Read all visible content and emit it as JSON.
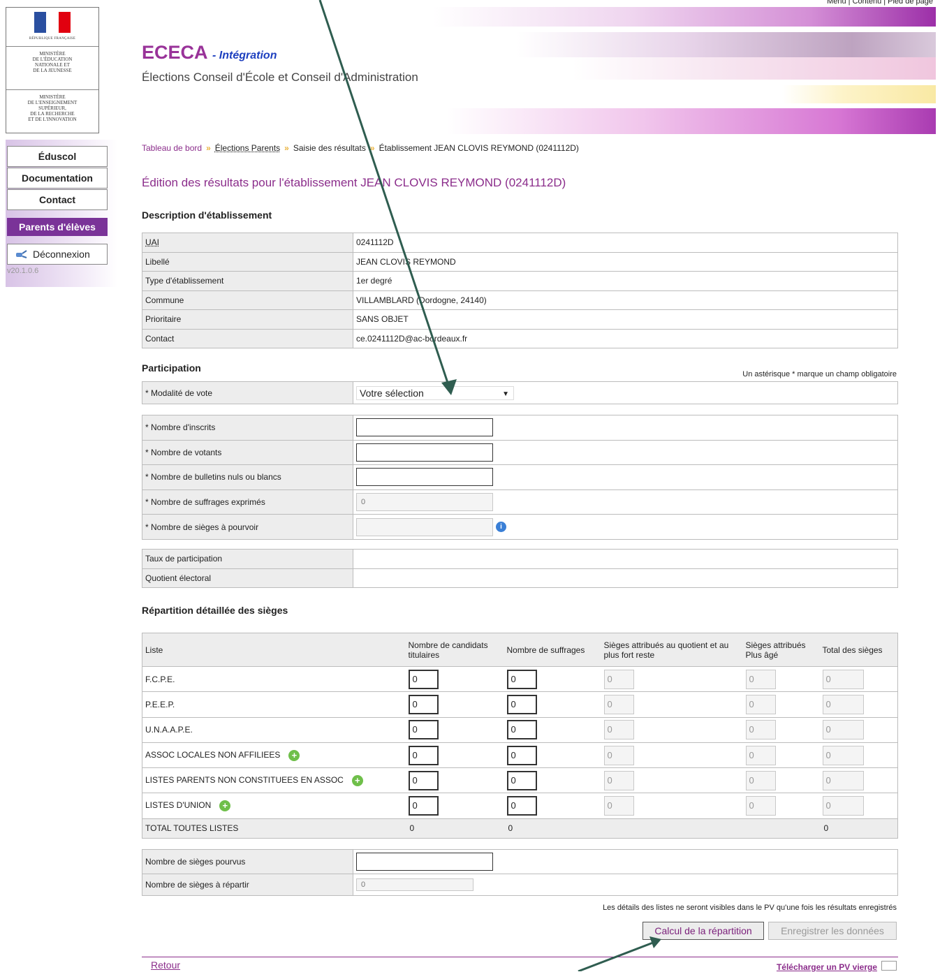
{
  "top_links": "Menu | Contenu | Pied de page",
  "app": {
    "title": "ECECA",
    "subtitle_tag": "- Intégration",
    "subtitle": "Élections Conseil d'École et Conseil d'Administration"
  },
  "logo": {
    "republique": "RÉPUBLIQUE FRANÇAISE",
    "ministry1": "MINISTÈRE\nDE L'ÉDUCATION\nNATIONALE ET\nDE LA JEUNESSE",
    "ministry2": "MINISTÈRE\nDE L'ENSEIGNEMENT\nSUPÉRIEUR,\nDE LA RECHERCHE\nET DE L'INNOVATION",
    "flag_colors": [
      "#2a4fa0",
      "#ffffff",
      "#e1000f"
    ]
  },
  "nav": {
    "items": [
      "Éduscol",
      "Documentation",
      "Contact"
    ],
    "active": "Parents d'élèves",
    "logout": "Déconnexion",
    "version": "v20.1.0.6"
  },
  "breadcrumb": [
    "Tableau de bord",
    "Élections Parents",
    "Saisie des résultats",
    "Établissement JEAN CLOVIS REYMOND (0241112D)"
  ],
  "page_title": "Édition des résultats pour l'établissement JEAN CLOVIS REYMOND (0241112D)",
  "description": {
    "heading": "Description d'établissement",
    "rows": [
      {
        "label": "UAI",
        "value": "0241112D"
      },
      {
        "label": "Libellé",
        "value": "JEAN CLOVIS REYMOND"
      },
      {
        "label": "Type d'établissement",
        "value": "1er degré"
      },
      {
        "label": "Commune",
        "value": "VILLAMBLARD (Dordogne, 24140)"
      },
      {
        "label": "Prioritaire",
        "value": "SANS OBJET"
      },
      {
        "label": "Contact",
        "value": "ce.0241112D@ac-bordeaux.fr"
      }
    ]
  },
  "participation": {
    "heading": "Participation",
    "required_note": "Un astérisque * marque un champ obligatoire",
    "modalite_label": "* Modalité de vote",
    "modalite_value": "Votre sélection",
    "fields": [
      {
        "label": "* Nombre d'inscrits",
        "value": ""
      },
      {
        "label": "* Nombre de votants",
        "value": ""
      },
      {
        "label": "* Nombre de bulletins nuls ou blancs",
        "value": ""
      },
      {
        "label": "* Nombre de suffrages exprimés",
        "value": "0"
      },
      {
        "label": "* Nombre de sièges à pourvoir",
        "value": ""
      }
    ],
    "stats": [
      "Taux de participation",
      "Quotient électoral"
    ]
  },
  "repartition": {
    "heading": "Répartition détaillée des sièges",
    "columns": [
      "Liste",
      "Nombre de candidats titulaires",
      "Nombre de suffrages",
      "Sièges attribués au quotient et au plus fort reste",
      "Sièges attribués Plus âgé",
      "Total des sièges"
    ],
    "rows": [
      {
        "name": "F.C.P.E.",
        "candidats": "0",
        "suffrages": "0",
        "quotient": "0",
        "plus_age": "0",
        "total": "0"
      },
      {
        "name": "P.E.E.P.",
        "candidats": "0",
        "suffrages": "0",
        "quotient": "0",
        "plus_age": "0",
        "total": "0"
      },
      {
        "name": "U.N.A.A.P.E.",
        "candidats": "0",
        "suffrages": "0",
        "quotient": "0",
        "plus_age": "0",
        "total": "0"
      },
      {
        "name": "ASSOC LOCALES NON AFFILIEES",
        "candidats": "0",
        "suffrages": "0",
        "quotient": "0",
        "plus_age": "0",
        "total": "0"
      },
      {
        "name": "LISTES PARENTS NON CONSTITUEES EN ASSOC",
        "candidats": "0",
        "suffrages": "0",
        "quotient": "0",
        "plus_age": "0",
        "total": "0"
      },
      {
        "name": "LISTES D'UNION",
        "candidats": "0",
        "suffrages": "0",
        "quotient": "0",
        "plus_age": "0",
        "total": "0"
      }
    ],
    "total_row": {
      "label": "TOTAL TOUTES LISTES",
      "candidats": "0",
      "suffrages": "0",
      "total": "0"
    },
    "pourvus_label": "Nombre de sièges pourvus",
    "pourvus_value": "",
    "repartir_label": "Nombre de sièges à répartir",
    "repartir_value": "0"
  },
  "lists_note": "Les détails des listes ne seront visibles dans le PV qu'une fois les résultats enregistrés",
  "buttons": {
    "calcul": "Calcul de la répartition",
    "enregistrer": "Enregistrer les données"
  },
  "footer": {
    "back": "Retour",
    "pv": "Télécharger un PV vierge"
  },
  "colors": {
    "accent": "#8b2d8b",
    "nav_active": "#7a3398",
    "arrow": "#2f5d50"
  }
}
